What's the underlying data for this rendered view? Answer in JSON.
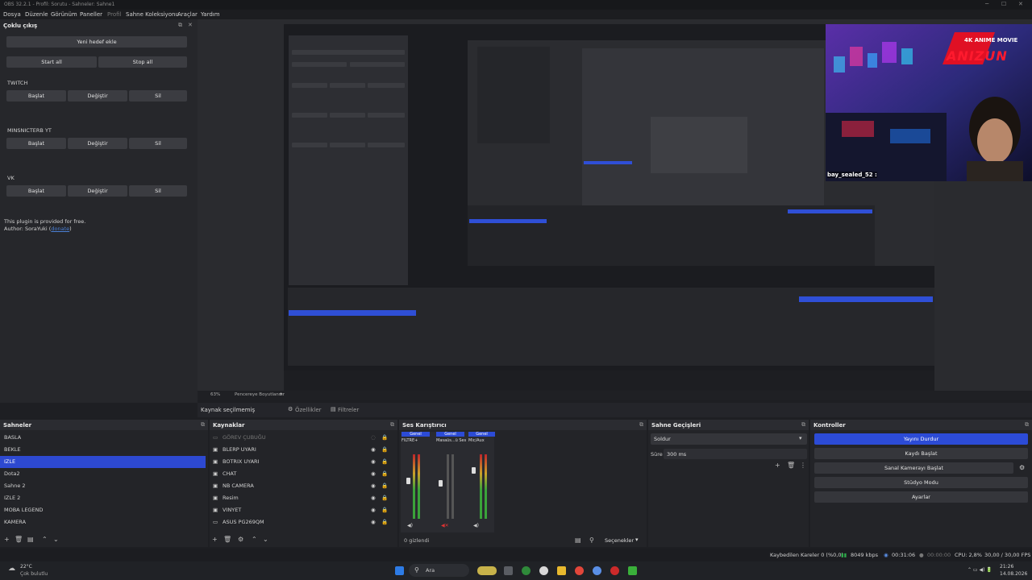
{
  "window": {
    "title": "OBS 32.2.1 - Profil: Sorutu - Sahneler: Sahne1"
  },
  "menu": [
    "Dosya",
    "Düzenle",
    "Görünüm",
    "Paneller",
    "Profil",
    "Sahne Koleksiyonu",
    "Araçlar",
    "Yardım"
  ],
  "multi_output": {
    "title": "Çoklu çıkış",
    "add_target": "Yeni hedef ekle",
    "start_all": "Start all",
    "stop_all": "Stop all",
    "targets": [
      {
        "name": "TWITCH",
        "start": "Başlat",
        "edit": "Değiştir",
        "delete": "Sil"
      },
      {
        "name": "MINSNICTERB YT",
        "start": "Başlat",
        "edit": "Değiştir",
        "delete": "Sil"
      },
      {
        "name": "VK",
        "start": "Başlat",
        "edit": "Değiştir",
        "delete": "Sil"
      }
    ],
    "footer_line1": "This plugin is provided for free.",
    "footer_author": "Author: SoraYuki (",
    "footer_link": "donate",
    "footer_end": ")"
  },
  "webcam": {
    "banner": "4K ANIME MOVIE",
    "brand": "ANIZUN",
    "chat_user": "bay_sealed_52 :"
  },
  "preview_status": {
    "zoom": "63%",
    "fit": "Pencereye Boyutlandır"
  },
  "source_bar": {
    "label": "Kaynak seçilmemiş",
    "properties": "Özellikler",
    "filters": "Filtreler"
  },
  "scenes": {
    "title": "Sahneler",
    "items": [
      "BASLA",
      "BEKLE",
      "IZLE",
      "Dota2",
      "Sahne 2",
      "IZLE 2",
      "MOBA LEGEND",
      "KAMERA"
    ],
    "selected": 2
  },
  "sources": {
    "title": "Kaynaklar",
    "items": [
      "GÖREV ÇUBUĞU",
      "BLERP UYARI",
      "BOTRIX UYARI",
      "CHAT",
      "NB CAMERA",
      "Resim",
      "VINYET",
      "ASUS PG269QM"
    ]
  },
  "mixer": {
    "title": "Ses Karıştırıcı",
    "channels": [
      {
        "tag": "Genel",
        "name": "FILTRE+"
      },
      {
        "tag": "Genel",
        "name": "Masaüs...ü Ses"
      },
      {
        "tag": "Genel",
        "name": "Mic/Aux"
      }
    ],
    "hidden": "0 gizlendi",
    "options": "Seçenekler"
  },
  "transitions": {
    "title": "Sahne Geçişleri",
    "type": "Soldur",
    "duration_label": "Süre",
    "duration": "300 ms"
  },
  "controls": {
    "title": "Kontroller",
    "buttons": [
      "Yayını Durdur",
      "Kaydı Başlat",
      "Sanal Kamerayı Başlat",
      "Stüdyo Modu",
      "Ayarlar"
    ]
  },
  "status": {
    "dropped": "Kaybedilen Kareler 0 (%0,0)",
    "bitrate": "8049 kbps",
    "stream_time": "00:31:06",
    "rec_time": "00:00:00",
    "cpu": "CPU: 2,8%",
    "fps": "30,00 / 30,00 FPS"
  },
  "taskbar": {
    "weather_temp": "22°C",
    "weather_desc": "Çok bulutlu",
    "search": "Ara",
    "time": "21:26",
    "date": "14.08.2026"
  },
  "colors": {
    "accent": "#2d49d1",
    "bg": "#1e1f23"
  }
}
